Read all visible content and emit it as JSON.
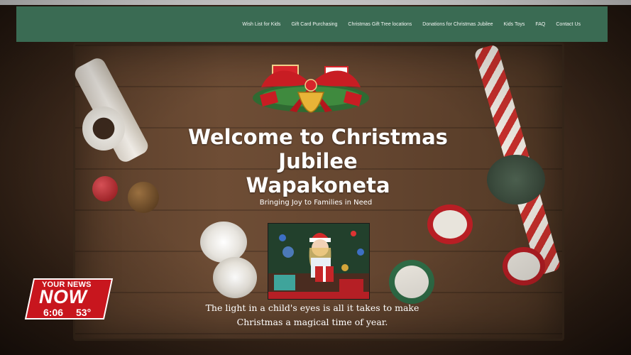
{
  "nav": {
    "items": [
      {
        "label": "Wish List for Kids"
      },
      {
        "label": "Gift Card Purchasing"
      },
      {
        "label": "Christmas Gift Tree locations"
      },
      {
        "label": "Donations for Christmas Jubilee"
      },
      {
        "label": "Kids Toys"
      },
      {
        "label": "FAQ"
      },
      {
        "label": "Contact Us"
      }
    ]
  },
  "hero": {
    "title_lines": [
      "Welcome to Christmas",
      "Jubilee",
      "Wapakoneta"
    ],
    "subtitle": "Bringing Joy to Families in Need",
    "tagline_lines": [
      "The light in a child's eyes is all it takes to make",
      "Christmas a magical time of year."
    ]
  },
  "broadcast": {
    "brand_top": "YOUR NEWS",
    "brand_main": "NOW",
    "time": "6:06",
    "temperature": "53°"
  },
  "colors": {
    "nav_bg": "#3a6b53",
    "news_red": "#c8161e"
  }
}
